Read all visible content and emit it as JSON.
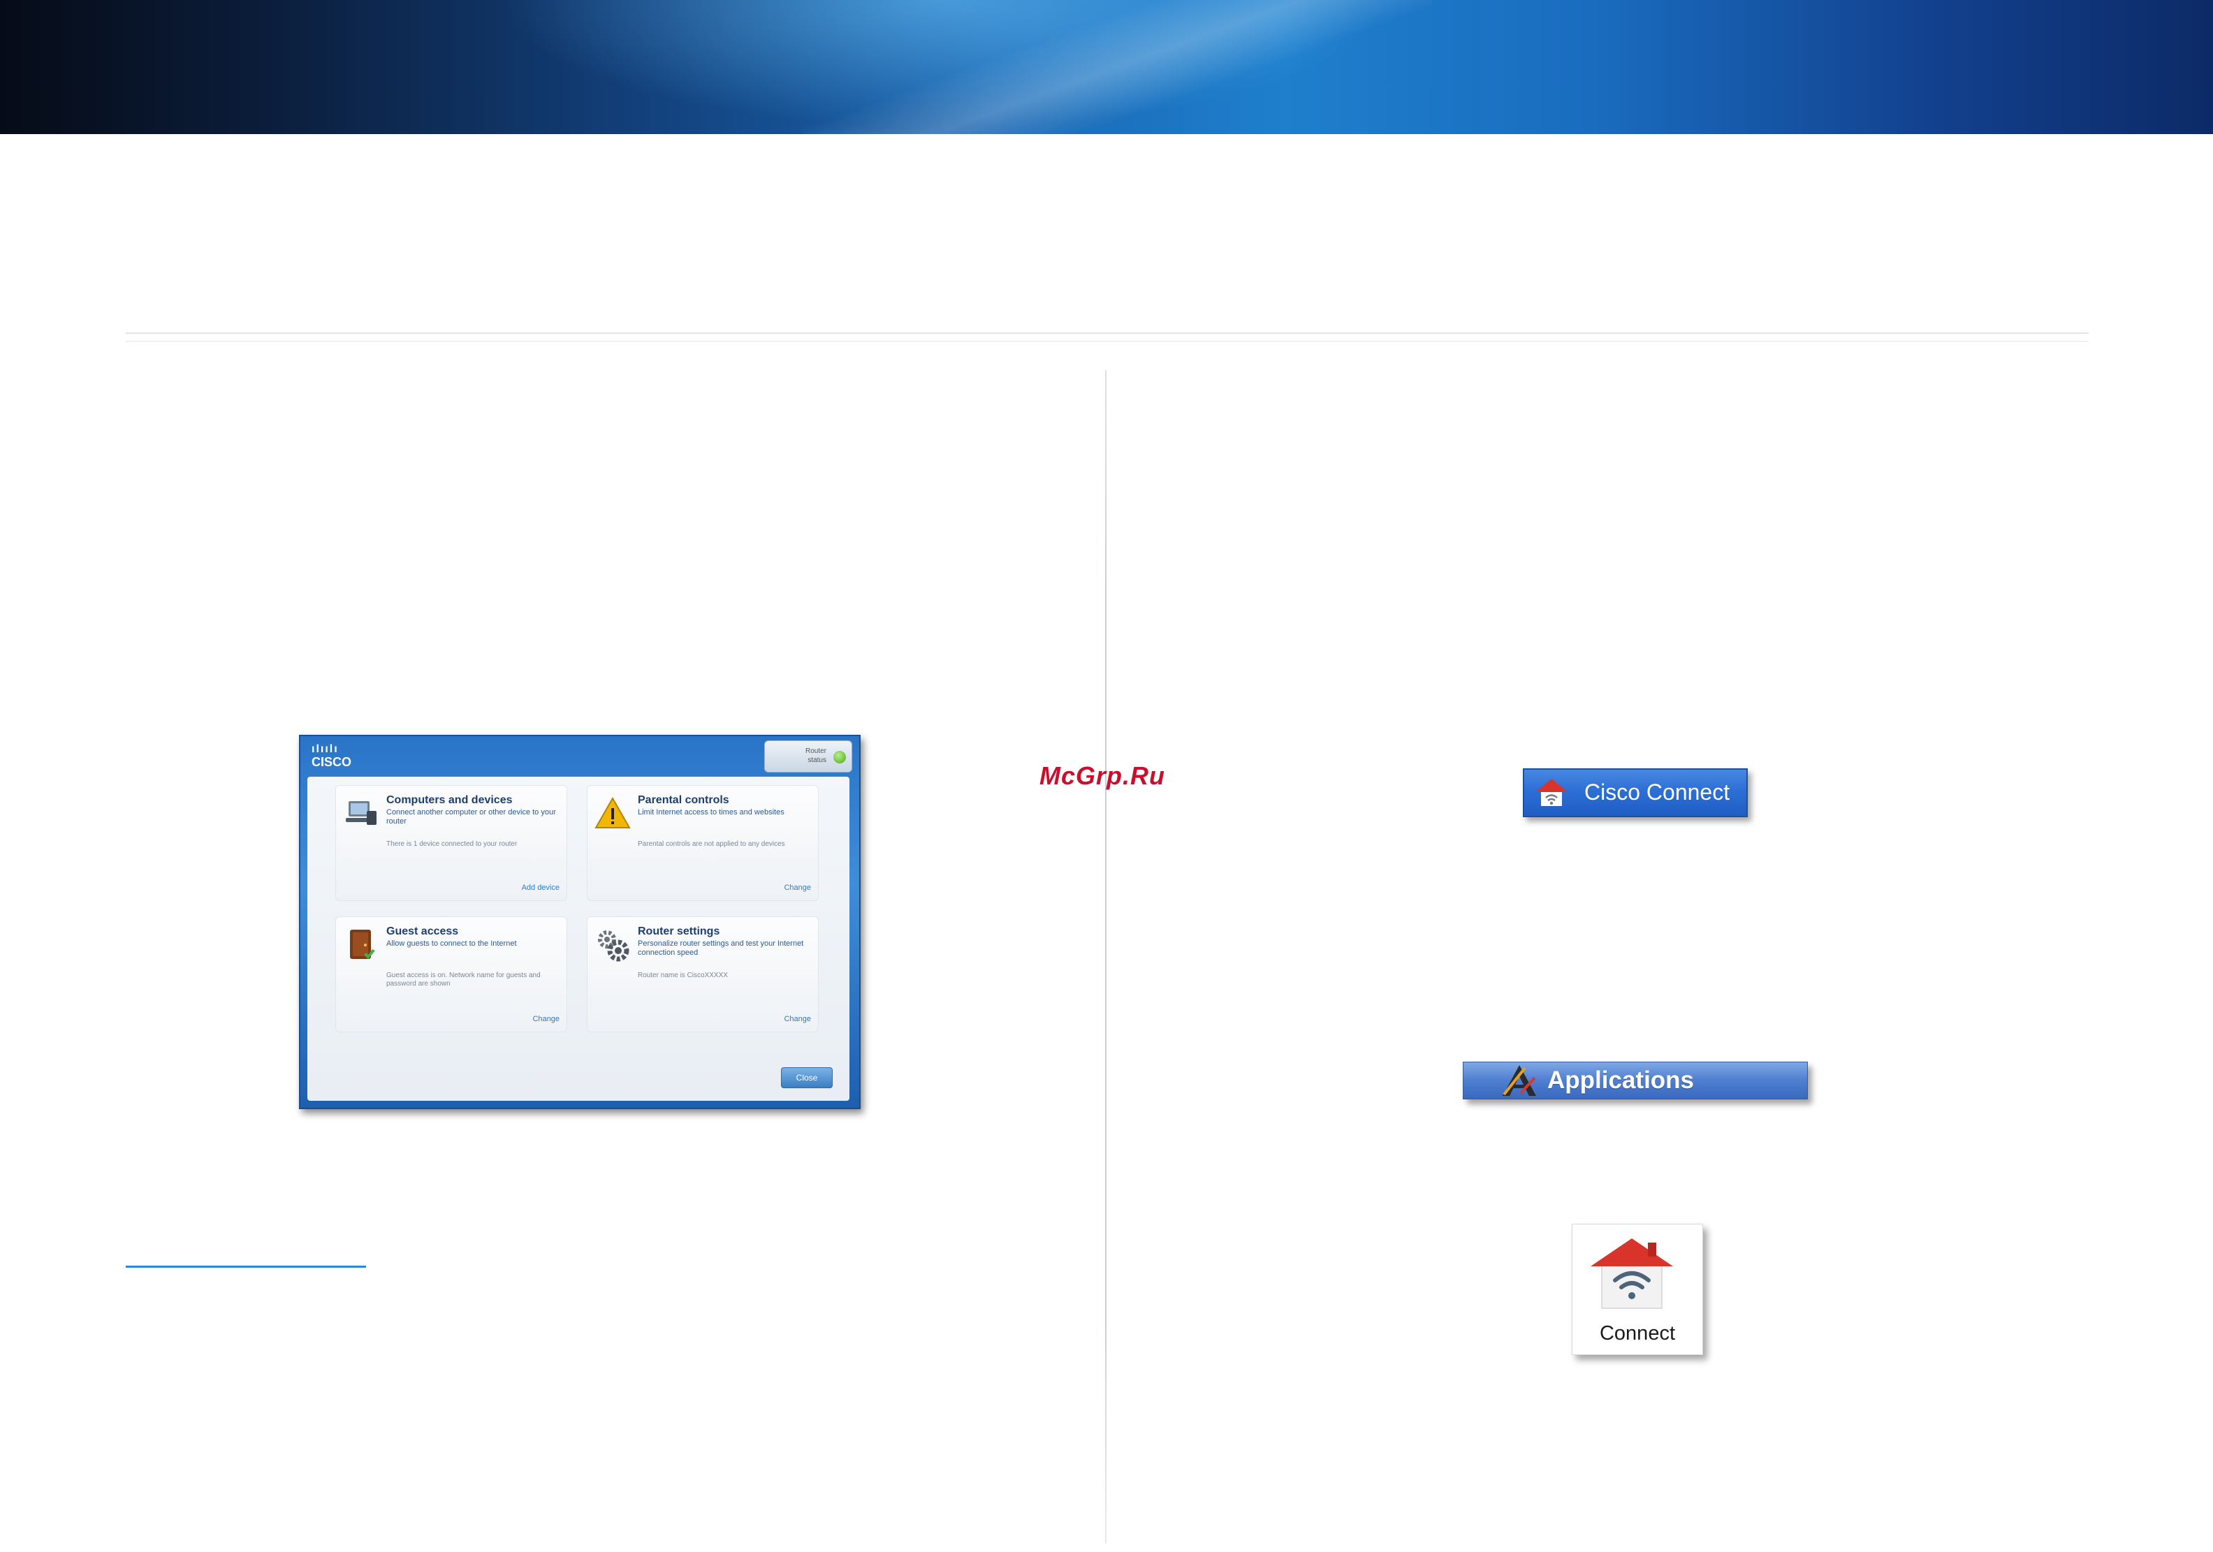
{
  "watermark": "McGrp.Ru",
  "cisco_connect_window": {
    "logo_bars": "ılıılı",
    "logo_text": "CISCO",
    "status_text": [
      "Router",
      "status"
    ],
    "tiles": [
      {
        "title": "Computers and devices",
        "description": "Connect another computer or other device to your router",
        "status": "There is 1 device connected to your router",
        "link": "Add device"
      },
      {
        "title": "Parental controls",
        "description": "Limit Internet access to times and websites",
        "status": "Parental controls are not applied to any devices",
        "link": "Change"
      },
      {
        "title": "Guest access",
        "description": "Allow guests to connect to the Internet",
        "status": "Guest access is on. Network name for guests and password are shown",
        "link": "Change"
      },
      {
        "title": "Router settings",
        "description": "Personalize router settings and test your Internet connection speed",
        "status": "Router name is CiscoXXXXX",
        "link": "Change"
      }
    ],
    "close_label": "Close"
  },
  "taskbar_button": {
    "label": "Cisco Connect",
    "icon": "cisco-connect-house-icon"
  },
  "applications_button": {
    "label": "Applications",
    "icon": "applications-a-icon"
  },
  "connect_tile": {
    "label": "Connect",
    "icon": "connect-house-wifi-icon"
  },
  "colors": {
    "banner_blue": "#1f7fcd",
    "link_blue": "#2a8ad8",
    "watermark_red": "#c8102e"
  }
}
